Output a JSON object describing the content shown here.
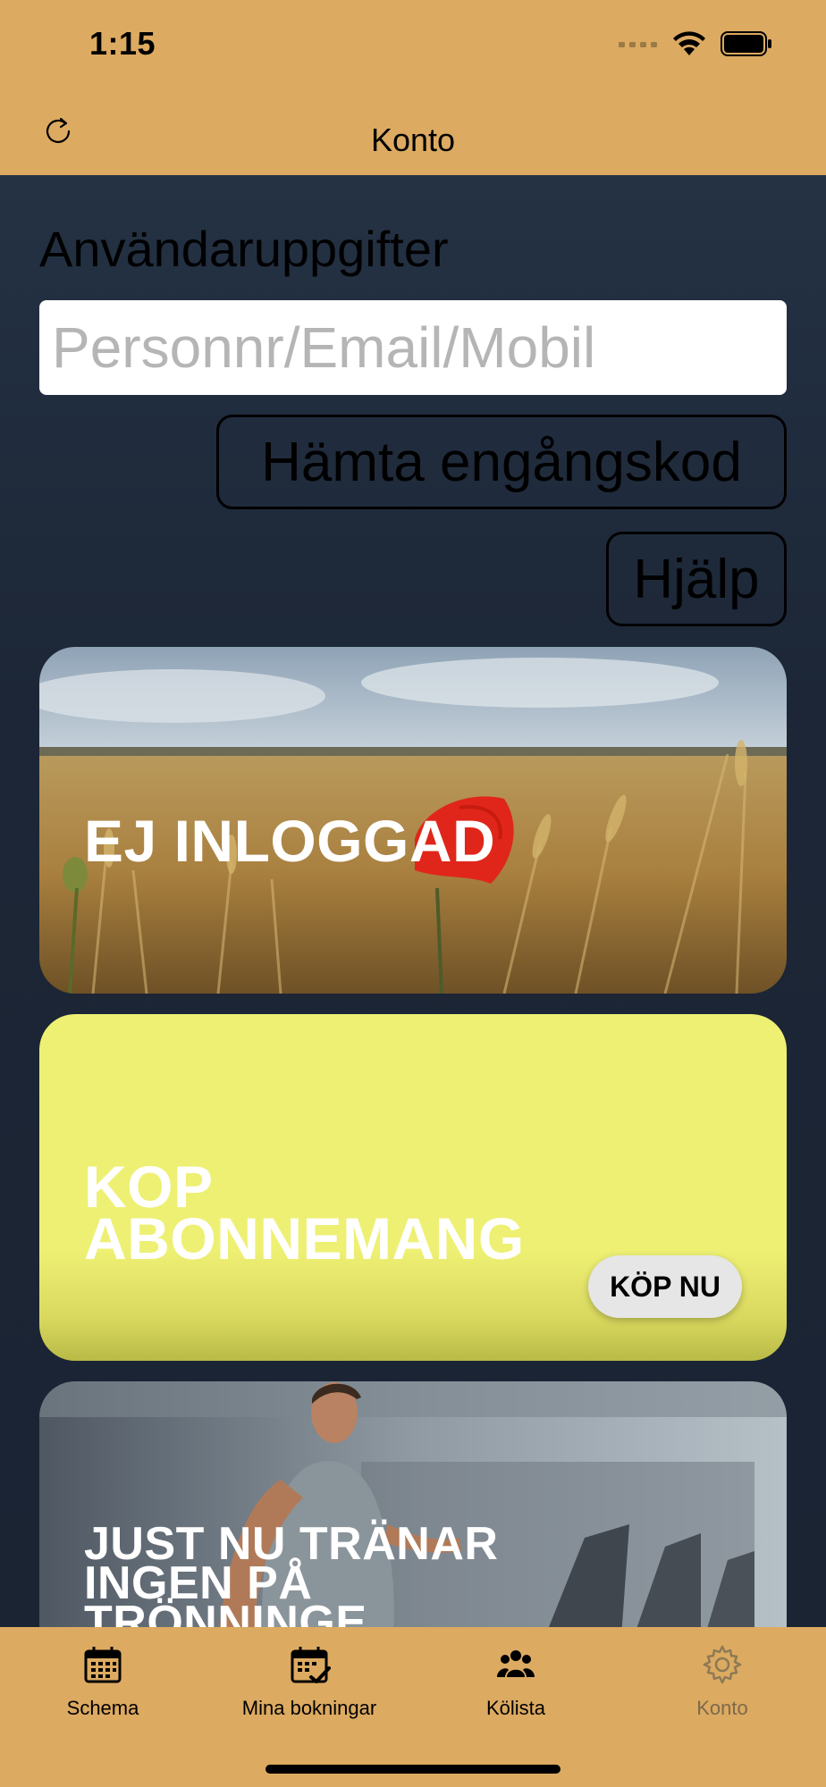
{
  "status_bar": {
    "time": "1:15"
  },
  "nav": {
    "title": "Konto"
  },
  "account": {
    "heading": "Användaruppgifter",
    "input_placeholder": "Personnr/Email/Mobil",
    "input_value": "",
    "get_code_label": "Hämta engångskod",
    "help_label": "Hjälp"
  },
  "cards": {
    "login_status": "EJ INLOGGAD",
    "buy_title_line1": "KOP",
    "buy_title_line2": "ABONNEMANG",
    "buy_button": "KÖP NU",
    "training_line1": "JUST NU TRÄNAR",
    "training_line2": "INGEN PÅ",
    "training_line3": "TRÖNNINGE"
  },
  "tabs": [
    {
      "label": "Schema",
      "icon": "calendar-icon",
      "active": false
    },
    {
      "label": "Mina bokningar",
      "icon": "calendar-check-icon",
      "active": false
    },
    {
      "label": "Kölista",
      "icon": "users-icon",
      "active": false
    },
    {
      "label": "Konto",
      "icon": "gear-icon",
      "active": true
    }
  ],
  "colors": {
    "bar": "#dcaa61",
    "background": "#1c2636",
    "card_yellow": "#eef074",
    "inactive_tab": "#7c6a4a"
  }
}
